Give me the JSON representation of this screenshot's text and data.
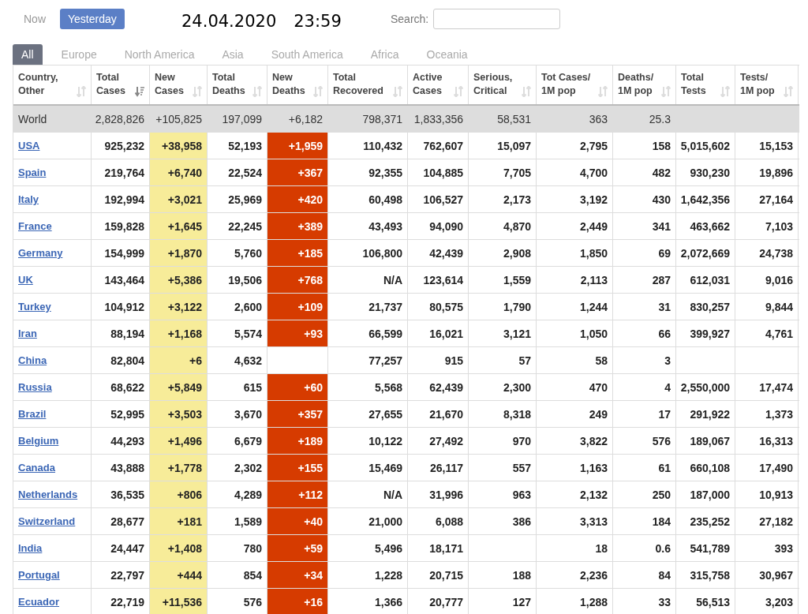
{
  "day_toggle": [
    {
      "label": "Now",
      "selected": false
    },
    {
      "label": "Yesterday",
      "selected": true
    }
  ],
  "timestamp": {
    "date": "24.04.2020",
    "time": "23:59"
  },
  "search": {
    "label": "Search:"
  },
  "region_tabs": [
    {
      "label": "All",
      "selected": true
    },
    {
      "label": "Europe",
      "selected": false
    },
    {
      "label": "North America",
      "selected": false
    },
    {
      "label": "Asia",
      "selected": false
    },
    {
      "label": "South America",
      "selected": false
    },
    {
      "label": "Africa",
      "selected": false
    },
    {
      "label": "Oceania",
      "selected": false
    }
  ],
  "table": {
    "columns": [
      {
        "label": "Country, Other",
        "sorted": false
      },
      {
        "label": "Total Cases",
        "sorted": true
      },
      {
        "label": "New Cases",
        "sorted": false
      },
      {
        "label": "Total Deaths",
        "sorted": false
      },
      {
        "label": "New Deaths",
        "sorted": false
      },
      {
        "label": "Total Recovered",
        "sorted": false
      },
      {
        "label": "Active Cases",
        "sorted": false
      },
      {
        "label": "Serious, Critical",
        "sorted": false
      },
      {
        "label": "Tot Cases/ 1M pop",
        "sorted": false
      },
      {
        "label": "Deaths/ 1M pop",
        "sorted": false
      },
      {
        "label": "Total Tests",
        "sorted": false
      },
      {
        "label": "Tests/ 1M pop",
        "sorted": false
      }
    ],
    "total_row": [
      "World",
      "2,828,826",
      "+105,825",
      "197,099",
      "+6,182",
      "798,371",
      "1,833,356",
      "58,531",
      "363",
      "25.3"
    ],
    "rows": [
      [
        "USA",
        "925,232",
        "+38,958",
        "52,193",
        "+1,959",
        "110,432",
        "762,607",
        "15,097",
        "2,795",
        "158",
        "5,015,602",
        "15,153"
      ],
      [
        "Spain",
        "219,764",
        "+6,740",
        "22,524",
        "+367",
        "92,355",
        "104,885",
        "7,705",
        "4,700",
        "482",
        "930,230",
        "19,896"
      ],
      [
        "Italy",
        "192,994",
        "+3,021",
        "25,969",
        "+420",
        "60,498",
        "106,527",
        "2,173",
        "3,192",
        "430",
        "1,642,356",
        "27,164"
      ],
      [
        "France",
        "159,828",
        "+1,645",
        "22,245",
        "+389",
        "43,493",
        "94,090",
        "4,870",
        "2,449",
        "341",
        "463,662",
        "7,103"
      ],
      [
        "Germany",
        "154,999",
        "+1,870",
        "5,760",
        "+185",
        "106,800",
        "42,439",
        "2,908",
        "1,850",
        "69",
        "2,072,669",
        "24,738"
      ],
      [
        "UK",
        "143,464",
        "+5,386",
        "19,506",
        "+768",
        "N/A",
        "123,614",
        "1,559",
        "2,113",
        "287",
        "612,031",
        "9,016"
      ],
      [
        "Turkey",
        "104,912",
        "+3,122",
        "2,600",
        "+109",
        "21,737",
        "80,575",
        "1,790",
        "1,244",
        "31",
        "830,257",
        "9,844"
      ],
      [
        "Iran",
        "88,194",
        "+1,168",
        "5,574",
        "+93",
        "66,599",
        "16,021",
        "3,121",
        "1,050",
        "66",
        "399,927",
        "4,761"
      ],
      [
        "China",
        "82,804",
        "+6",
        "4,632",
        "",
        "77,257",
        "915",
        "57",
        "58",
        "3",
        "",
        ""
      ],
      [
        "Russia",
        "68,622",
        "+5,849",
        "615",
        "+60",
        "5,568",
        "62,439",
        "2,300",
        "470",
        "4",
        "2,550,000",
        "17,474"
      ],
      [
        "Brazil",
        "52,995",
        "+3,503",
        "3,670",
        "+357",
        "27,655",
        "21,670",
        "8,318",
        "249",
        "17",
        "291,922",
        "1,373"
      ],
      [
        "Belgium",
        "44,293",
        "+1,496",
        "6,679",
        "+189",
        "10,122",
        "27,492",
        "970",
        "3,822",
        "576",
        "189,067",
        "16,313"
      ],
      [
        "Canada",
        "43,888",
        "+1,778",
        "2,302",
        "+155",
        "15,469",
        "26,117",
        "557",
        "1,163",
        "61",
        "660,108",
        "17,490"
      ],
      [
        "Netherlands",
        "36,535",
        "+806",
        "4,289",
        "+112",
        "N/A",
        "31,996",
        "963",
        "2,132",
        "250",
        "187,000",
        "10,913"
      ],
      [
        "Switzerland",
        "28,677",
        "+181",
        "1,589",
        "+40",
        "21,000",
        "6,088",
        "386",
        "3,313",
        "184",
        "235,252",
        "27,182"
      ],
      [
        "India",
        "24,447",
        "+1,408",
        "780",
        "+59",
        "5,496",
        "18,171",
        "",
        "18",
        "0.6",
        "541,789",
        "393"
      ],
      [
        "Portugal",
        "22,797",
        "+444",
        "854",
        "+34",
        "1,228",
        "20,715",
        "188",
        "2,236",
        "84",
        "315,758",
        "30,967"
      ],
      [
        "Ecuador",
        "22,719",
        "+11,536",
        "576",
        "+16",
        "1,366",
        "20,777",
        "127",
        "1,288",
        "33",
        "56,513",
        "3,203"
      ]
    ]
  }
}
